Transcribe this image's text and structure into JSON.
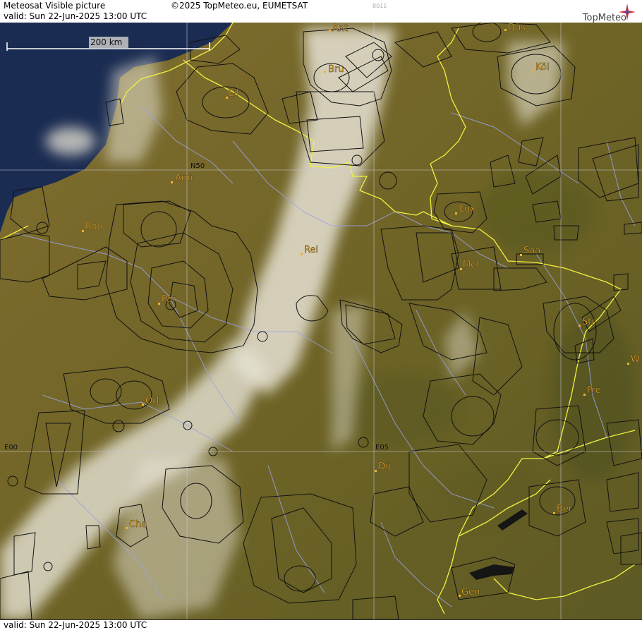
{
  "header": {
    "title": "Meteosat Visible picture",
    "valid": "valid:  Sun  22-Jun-2025  13:00 UTC",
    "copyright": "©2025 TopMeteo.eu, EUMETSAT",
    "image_code": "8011",
    "logo_text": "TopMeteo"
  },
  "footer": {
    "valid": "valid:  Sun  22-Jun-2025  13:00 UTC"
  },
  "scale_bar": {
    "label": "200 km"
  },
  "grid_labels": {
    "lat50": "N50",
    "lon0": "E00",
    "lon5": "E05"
  },
  "cities": [
    {
      "name": "Ant"
    },
    {
      "name": "Düs"
    },
    {
      "name": "Bru"
    },
    {
      "name": "Köl"
    },
    {
      "name": "Lil"
    },
    {
      "name": "Ami"
    },
    {
      "name": "Lux"
    },
    {
      "name": "Rou"
    },
    {
      "name": "Rei"
    },
    {
      "name": "Saa"
    },
    {
      "name": "Met"
    },
    {
      "name": "Par"
    },
    {
      "name": "Str"
    },
    {
      "name": "W"
    },
    {
      "name": "Fre"
    },
    {
      "name": "Orl"
    },
    {
      "name": "Dij"
    },
    {
      "name": "Ber"
    },
    {
      "name": "Cha"
    },
    {
      "name": "Gen"
    }
  ],
  "colors": {
    "land": "#7a6a2a",
    "sea": "#1c2f55",
    "cloud": "#e8e4d8",
    "border": "#ffff40",
    "river": "#9aa0e0",
    "airspace": "#111111",
    "city": "#f0b030"
  }
}
